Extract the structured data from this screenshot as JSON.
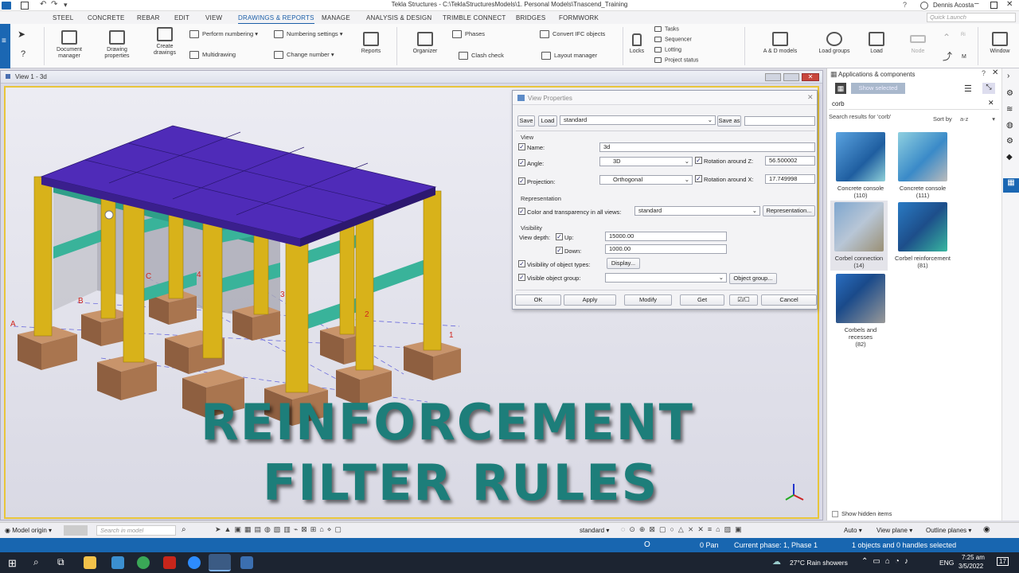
{
  "window": {
    "title": "Tekla Structures - C:\\TeklaStructuresModels\\1. Personal Models\\Tnascend_Training",
    "user": "Dennis Acosta",
    "quick_launch_placeholder": "Quick Launch"
  },
  "ribbon_tabs": [
    "STEEL",
    "CONCRETE",
    "REBAR",
    "EDIT",
    "VIEW",
    "DRAWINGS & REPORTS",
    "MANAGE",
    "ANALYSIS & DESIGN",
    "TRIMBLE CONNECT",
    "BRIDGES",
    "FORMWORK"
  ],
  "ribbon": {
    "document_manager": "Document manager",
    "drawing_properties": "Drawing properties",
    "create_drawings": "Create drawings",
    "perform_numbering": "Perform numbering",
    "multidrawing": "Multidrawing",
    "numbering_settings": "Numbering settings",
    "change_number": "Change number",
    "reports": "Reports",
    "organizer": "Organizer",
    "phases": "Phases",
    "clash_check": "Clash check",
    "convert_ifc": "Convert IFC objects",
    "layout_manager": "Layout manager",
    "locks": "Locks",
    "tasks": "Tasks",
    "sequencer": "Sequencer",
    "lotting": "Lotting",
    "project_status": "Project status",
    "ad_models": "A & D models",
    "load_groups": "Load groups",
    "load": "Load",
    "node": "Node",
    "rigid": "Ri",
    "m": "M",
    "window": "Window"
  },
  "view": {
    "title": "View 1 - 3d"
  },
  "grid_labels": {
    "a": "A",
    "b": "B",
    "c": "C",
    "one": "1",
    "two": "2",
    "three": "3",
    "four": "4"
  },
  "view_properties": {
    "title": "View Properties",
    "save": "Save",
    "load": "Load",
    "preset": "standard",
    "save_as": "Save as",
    "save_as_value": "",
    "section_view": "View",
    "name_label": "Name:",
    "name_value": "3d",
    "angle_label": "Angle:",
    "angle_value": "3D",
    "rotation_z_label": "Rotation around Z:",
    "rotation_z_value": "56.500002",
    "projection_label": "Projection:",
    "projection_value": "Orthogonal",
    "rotation_x_label": "Rotation around X:",
    "rotation_x_value": "17.749998",
    "section_representation": "Representation",
    "color_label": "Color and transparency in all views:",
    "color_value": "standard",
    "representation_button": "Representation...",
    "section_visibility": "Visibility",
    "view_depth_label": "View depth:",
    "up_label": "Up:",
    "up_value": "15000.00",
    "down_label": "Down:",
    "down_value": "1000.00",
    "visibility_types_label": "Visibility of object types:",
    "display_button": "Display...",
    "visible_group_label": "Visible object group:",
    "visible_group_value": "",
    "object_group_button": "Object group...",
    "ok": "OK",
    "apply": "Apply",
    "modify": "Modify",
    "get": "Get",
    "cancel": "Cancel"
  },
  "apps_panel": {
    "title": "Applications & components",
    "show_selected": "Show selected",
    "search_value": "corb",
    "results_label": "Search results for 'corb'",
    "sort_label": "Sort by",
    "sort_value": "a-z",
    "items": [
      {
        "label": "Concrete console",
        "count": "(110)"
      },
      {
        "label": "Concrete console",
        "count": "(111)"
      },
      {
        "label": "Corbel connection",
        "count": "(14)"
      },
      {
        "label": "Corbel reinforcement",
        "count": "(81)"
      },
      {
        "label": "Corbels and recesses",
        "count": "(82)"
      }
    ],
    "show_hidden": "Show hidden items"
  },
  "overlay": {
    "line1": "REINFORCEMENT",
    "line2": "FILTER RULES"
  },
  "bottom_toolbar": {
    "model_origin": "Model origin",
    "search_placeholder": "Search in model",
    "standard": "standard",
    "auto": "Auto",
    "view_plane": "View plane",
    "outline_planes": "Outline planes"
  },
  "status": {
    "o": "O",
    "pan": "0 Pan",
    "phase": "Current phase: 1, Phase 1",
    "selection": "1 objects and 0 handles selected"
  },
  "taskbar": {
    "weather": "27°C  Rain showers",
    "lang": "ENG",
    "time": "7:25 am",
    "date": "3/5/2022",
    "notif": "17"
  },
  "colors": {
    "roof": "#4f2bb8",
    "column": "#d8b21a",
    "beam": "#39b39a",
    "footing": "#b07a55",
    "accent": "#1b67b3"
  }
}
